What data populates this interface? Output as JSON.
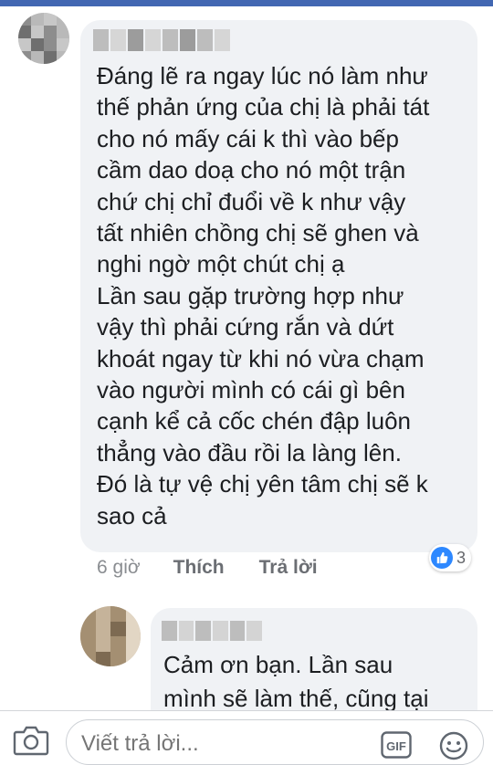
{
  "comment": {
    "lines": [
      "Đáng lẽ ra ngay lúc nó làm như",
      "thế phản ứng của chị là phải tát",
      "cho nó mấy cái k thì vào bếp",
      "cầm dao doạ cho nó một trận",
      "chứ chị chỉ đuổi về k như vậy",
      "tất nhiên chồng chị sẽ ghen và",
      "nghi ngờ một chút chị ạ",
      "Lần sau gặp trường hợp như",
      "vậy thì phải cứng rắn và dứt",
      "khoát ngay từ khi nó vừa chạm",
      "vào người mình có cái gì bên",
      "cạnh kể cả cốc chén đập luôn",
      "thẳng vào đầu rồi la làng lên.",
      "Đó là tự vệ chị yên tâm chị sẽ k",
      "sao cả"
    ],
    "time": "6 giờ",
    "like_label": "Thích",
    "reply_label": "Trả lời",
    "reaction_count": "3",
    "reaction_type": "like"
  },
  "reply": {
    "lines": [
      "Cảm ơn bạn. Lần sau",
      "mình sẽ làm thế, cũng tại"
    ]
  },
  "composer": {
    "placeholder": "Viết trả lời...",
    "camera_icon": "camera-icon",
    "gif_label": "GIF",
    "emoji_icon": "emoji-icon"
  },
  "colors": {
    "bubble": "#f0f2f5",
    "like_blue": "#2d88ff",
    "text": "#1c1e21",
    "meta": "#65676b",
    "top_bar": "#4267b2"
  }
}
